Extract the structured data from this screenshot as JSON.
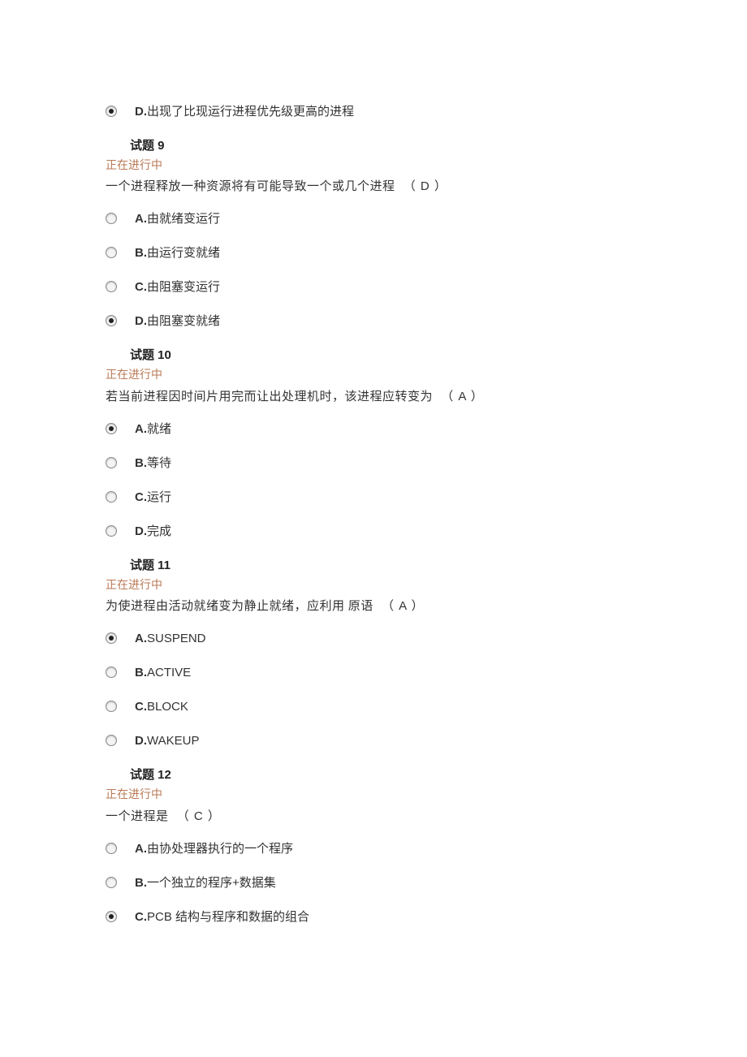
{
  "q8_tail": {
    "options": [
      {
        "label": "D.",
        "text": "出现了比现运行进程优先级更高的进程",
        "selected": true
      }
    ]
  },
  "q9": {
    "title": "试题 9",
    "status": "正在进行中",
    "stem": "一个进程释放一种资源将有可能导致一个或几个进程",
    "answer": "（ D ）",
    "options": [
      {
        "label": "A.",
        "text": "由就绪变运行",
        "selected": false
      },
      {
        "label": "B.",
        "text": "由运行变就绪",
        "selected": false
      },
      {
        "label": "C.",
        "text": "由阻塞变运行",
        "selected": false
      },
      {
        "label": "D.",
        "text": "由阻塞变就绪",
        "selected": true
      }
    ]
  },
  "q10": {
    "title": "试题 10",
    "status": "正在进行中",
    "stem": "若当前进程因时间片用完而让出处理机时，该进程应转变为",
    "answer": "（ A ）",
    "options": [
      {
        "label": "A.",
        "text": "就绪",
        "selected": true
      },
      {
        "label": "B.",
        "text": "等待",
        "selected": false
      },
      {
        "label": "C.",
        "text": "运行",
        "selected": false
      },
      {
        "label": "D.",
        "text": "完成",
        "selected": false
      }
    ]
  },
  "q11": {
    "title": "试题 11",
    "status": "正在进行中",
    "stem": "为使进程由活动就绪变为静止就绪，应利用  原语",
    "answer": "（ A ）",
    "options": [
      {
        "label": "A.",
        "text": "SUSPEND",
        "selected": true
      },
      {
        "label": "B.",
        "text": "ACTIVE",
        "selected": false
      },
      {
        "label": "C.",
        "text": "BLOCK",
        "selected": false
      },
      {
        "label": "D.",
        "text": "WAKEUP",
        "selected": false
      }
    ]
  },
  "q12": {
    "title": "试题 12",
    "status": "正在进行中",
    "stem": "一个进程是",
    "answer": "（ C ）",
    "options": [
      {
        "label": "A.",
        "text": "由协处理器执行的一个程序",
        "selected": false
      },
      {
        "label": "B.",
        "text": "一个独立的程序+数据集",
        "selected": false
      },
      {
        "label": "C.",
        "text": "PCB 结构与程序和数据的组合",
        "selected": true
      }
    ]
  }
}
